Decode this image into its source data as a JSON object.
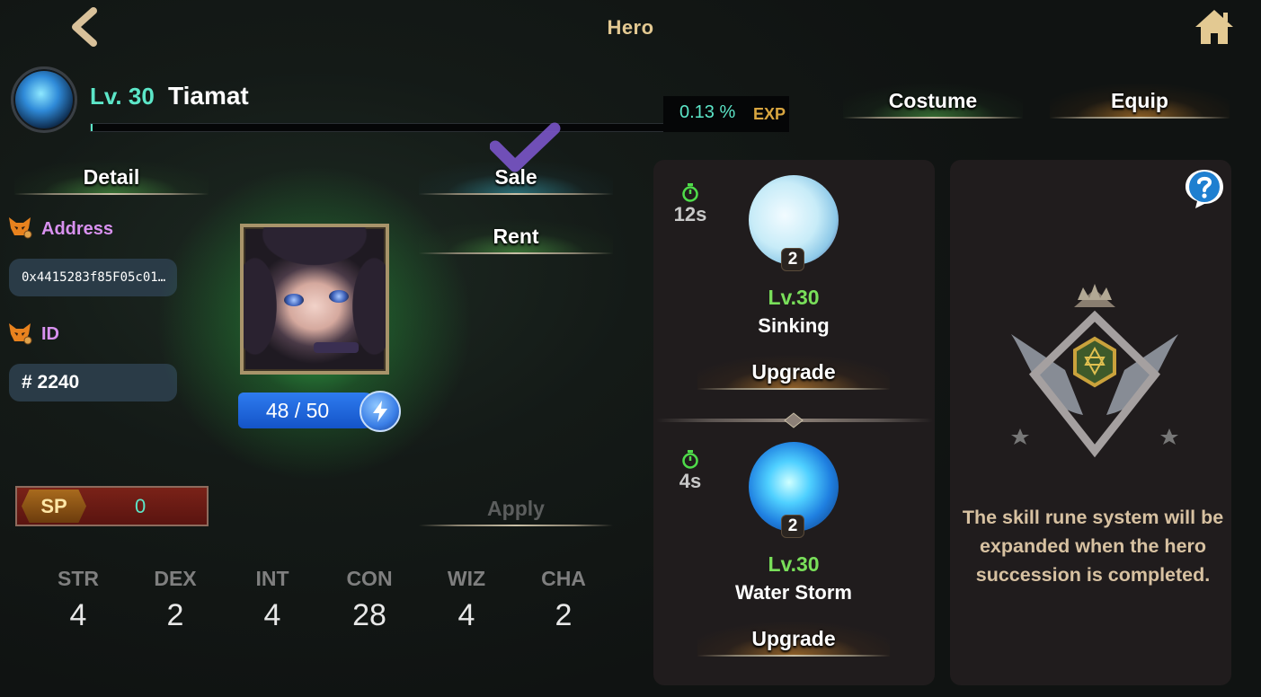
{
  "header": {
    "title": "Hero",
    "back_icon": "chevron-left-icon",
    "home_icon": "home-icon"
  },
  "hero": {
    "level_label": "Lv. 30",
    "name": "Tiamat",
    "exp_percent_text": "0.13 %",
    "exp_label": "EXP",
    "exp_progress": 0.0013
  },
  "tabs": {
    "costume": "Costume",
    "equip": "Equip",
    "detail": "Detail",
    "sale": "Sale",
    "rent": "Rent",
    "apply": "Apply"
  },
  "info": {
    "address_label": "Address",
    "address_value": "0x4415283f85F05c01…",
    "id_label": "ID",
    "id_value": "# 2240"
  },
  "energy": {
    "text": "48 / 50",
    "icon": "lightning-icon"
  },
  "sp": {
    "label": "SP",
    "value": "0"
  },
  "stats": [
    {
      "name": "STR",
      "value": "4"
    },
    {
      "name": "DEX",
      "value": "2"
    },
    {
      "name": "INT",
      "value": "4"
    },
    {
      "name": "CON",
      "value": "28"
    },
    {
      "name": "WIZ",
      "value": "4"
    },
    {
      "name": "CHA",
      "value": "2"
    }
  ],
  "skills": [
    {
      "cooldown": "12s",
      "rank": "2",
      "level": "Lv.30",
      "name": "Sinking",
      "upgrade_label": "Upgrade"
    },
    {
      "cooldown": "4s",
      "rank": "2",
      "level": "Lv.30",
      "name": "Water Storm",
      "upgrade_label": "Upgrade"
    }
  ],
  "rune": {
    "message": "The skill rune system will be expanded when the hero succession is completed.",
    "help_icon": "question-icon"
  },
  "colors": {
    "accent_teal": "#5ce6c8",
    "title_gold": "#e3c992",
    "label_purple": "#d891ef",
    "skill_level_green": "#79df5a",
    "energy_blue": "#2e7cf0"
  }
}
